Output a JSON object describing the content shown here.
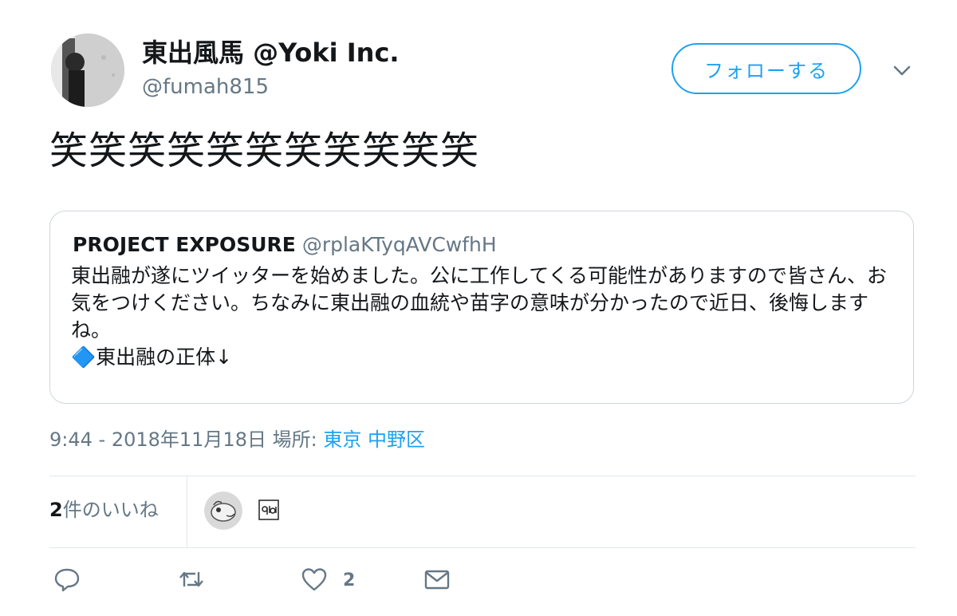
{
  "author": {
    "display_name": "東出風馬 @Yoki Inc.",
    "handle": "@fumah815"
  },
  "follow_button": {
    "label": "フォローする"
  },
  "tweet": {
    "text": "笑笑笑笑笑笑笑笑笑笑笑"
  },
  "quoted_tweet": {
    "name": "PROJECT EXPOSURE",
    "handle": "@rplaKTyqAVCwfhH",
    "body": "東出融が遂にツイッターを始めました。公に工作してくる可能性がありますので皆さん、お気をつけください。ちなみに東出融の血統や苗字の意味が分かったので近日、後悔しますね。\n🔷東出融の正体↓"
  },
  "meta": {
    "timestamp": "9:44 - 2018年11月18日",
    "location_label": "場所:",
    "location": "東京 中野区"
  },
  "likes": {
    "count": "2",
    "label": "件のいいね"
  },
  "actions": {
    "like_count": "2"
  },
  "icons": [
    "chevron-down-icon",
    "reply-icon",
    "retweet-icon",
    "heart-icon",
    "envelope-icon"
  ],
  "colors": {
    "accent": "#1da1f2",
    "secondary_text": "#657786",
    "border": "#ccd6dd"
  }
}
